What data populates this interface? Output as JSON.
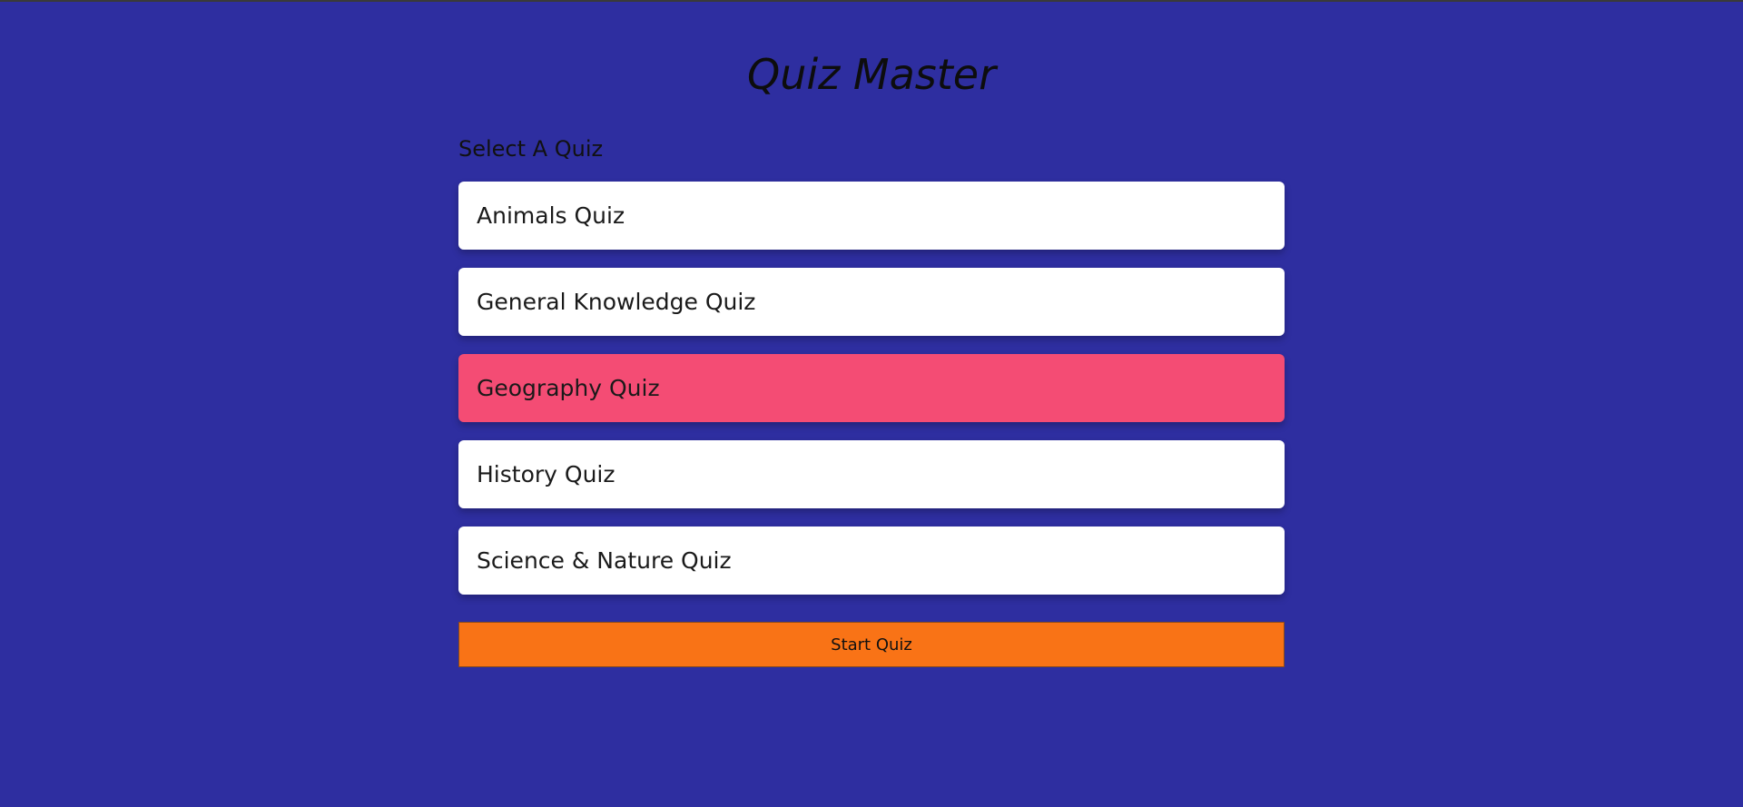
{
  "app": {
    "title": "Quiz Master"
  },
  "quiz_select": {
    "label": "Select A Quiz",
    "items": [
      {
        "label": "Animals Quiz",
        "selected": false
      },
      {
        "label": "General Knowledge Quiz",
        "selected": false
      },
      {
        "label": "Geography Quiz",
        "selected": true
      },
      {
        "label": "History Quiz",
        "selected": false
      },
      {
        "label": "Science & Nature Quiz",
        "selected": false
      }
    ]
  },
  "actions": {
    "start_label": "Start Quiz"
  },
  "colors": {
    "background": "#2e2ea0",
    "item_default": "#ffffff",
    "item_selected": "#f44c74",
    "start_button": "#f97316"
  }
}
